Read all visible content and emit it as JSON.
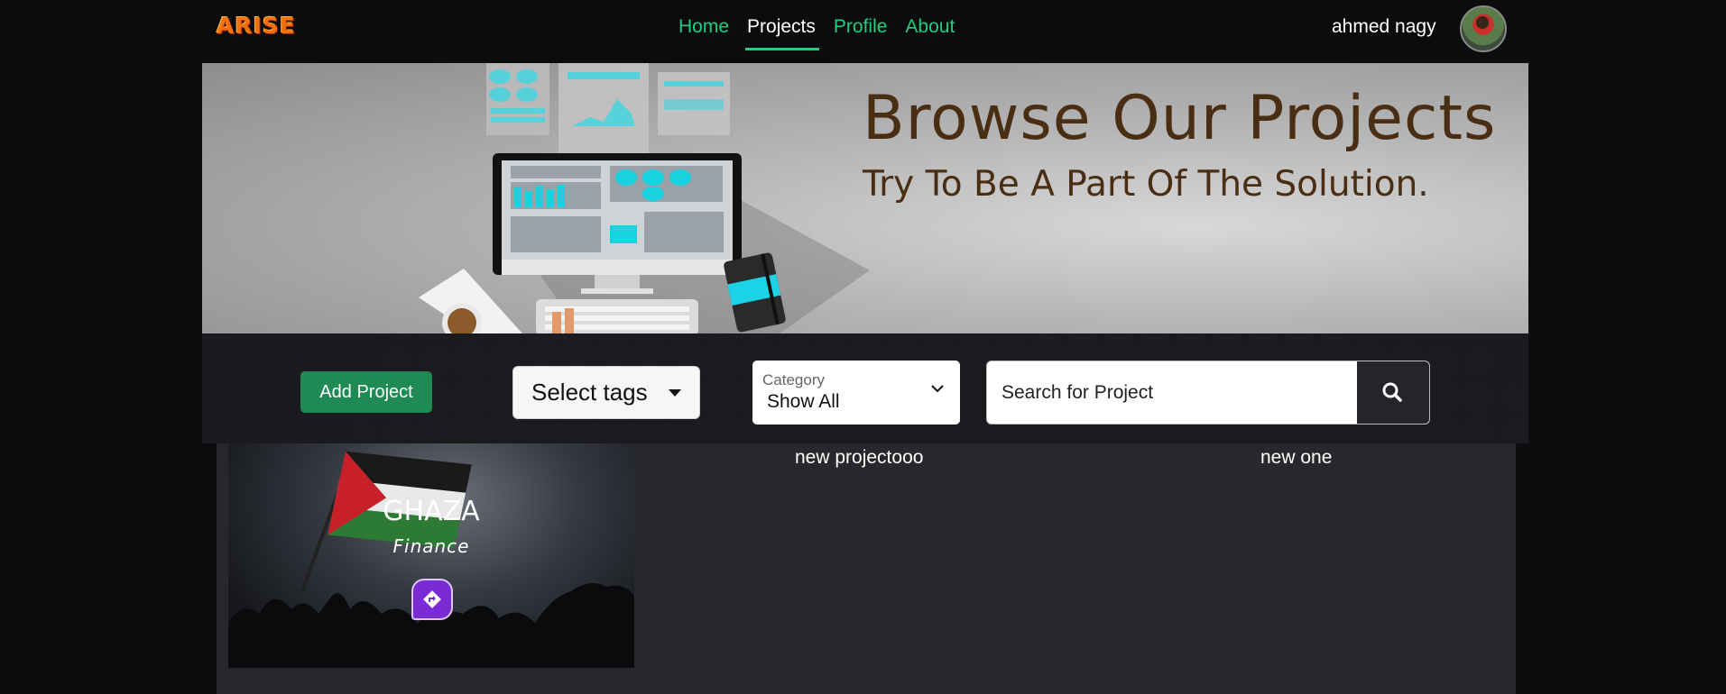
{
  "navbar": {
    "logo": "ARISE",
    "links": [
      {
        "label": "Home",
        "active": false
      },
      {
        "label": "Projects",
        "active": true
      },
      {
        "label": "Profile",
        "active": false
      },
      {
        "label": "About",
        "active": false
      }
    ],
    "user_name": "ahmed nagy",
    "accent_color": "#1fcf7f"
  },
  "hero": {
    "title": "Browse Our Projects",
    "subtitle": "Try To Be A Part Of The Solution.",
    "text_color": "#4a2e14"
  },
  "filters": {
    "add_button_label": "Add Project",
    "tags_button_label": "Select tags",
    "category_label": "Category",
    "category_value": "Show All",
    "search_placeholder": "Search for Project"
  },
  "projects": [
    {
      "title": "GHAZA",
      "category": "Finance"
    },
    {
      "title": "new projectooo"
    },
    {
      "title": "new one"
    }
  ]
}
